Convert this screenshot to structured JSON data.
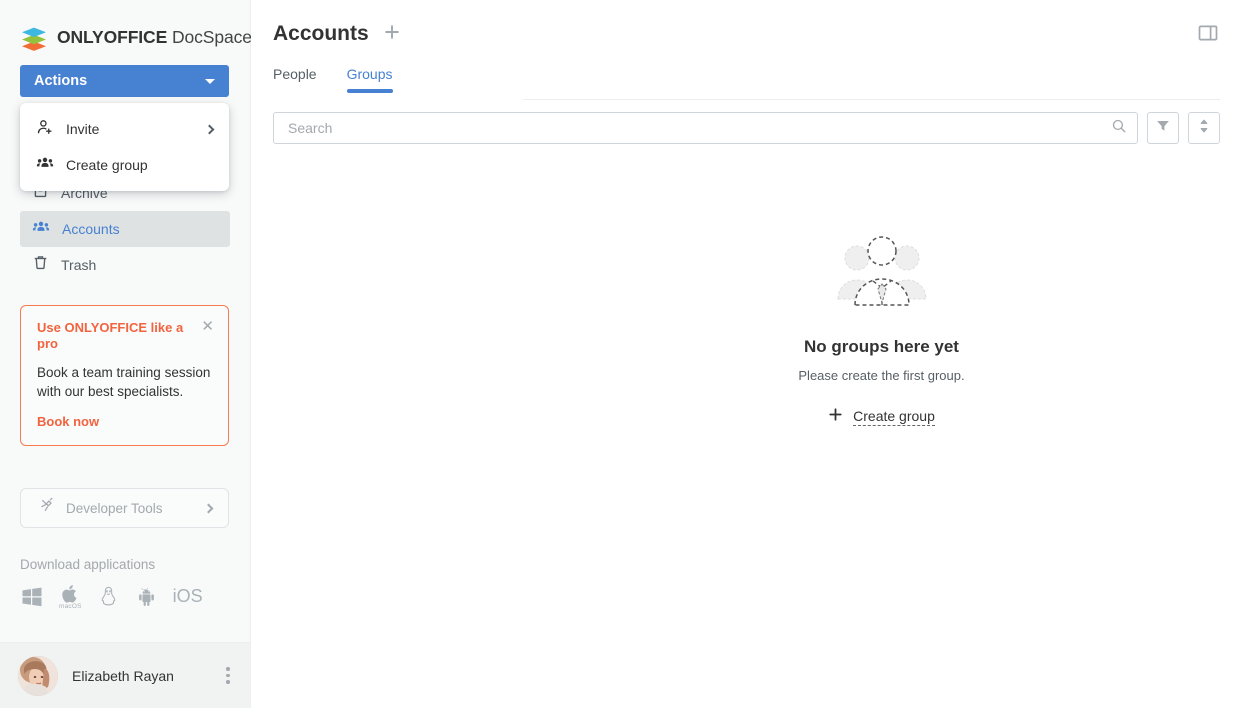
{
  "brand": {
    "bold": "ONLYOFFICE",
    "light": "DocSpace",
    "logo_icon": "onlyoffice-stack-logo"
  },
  "sidebar": {
    "actions_button": {
      "label": "Actions",
      "caret_icon": "chevron-down-icon"
    },
    "dropdown": {
      "items": [
        {
          "label": "Invite",
          "icon": "person-add-icon",
          "submenu_icon": "chevron-right-icon"
        },
        {
          "label": "Create group",
          "icon": "group-icon"
        }
      ]
    },
    "nav": [
      {
        "label": "Archive",
        "icon": "archive-icon",
        "active": false
      },
      {
        "label": "Accounts",
        "icon": "group-icon",
        "active": true
      },
      {
        "label": "Trash",
        "icon": "trash-icon",
        "active": false
      }
    ],
    "promo": {
      "title": "Use ONLYOFFICE like a pro",
      "close_icon": "close-icon",
      "body": "Book a team training session with our best specialists.",
      "link": "Book now",
      "border_color": "#f97a4d",
      "accent_color": "#f2643f"
    },
    "developer_tools": {
      "label": "Developer Tools",
      "icon": "api-plug-icon",
      "chevron_icon": "chevron-right-icon"
    },
    "downloads": {
      "title": "Download applications",
      "items": [
        {
          "name": "windows-icon",
          "label": ""
        },
        {
          "name": "apple-macos-icon",
          "label": "macOS"
        },
        {
          "name": "linux-penguin-icon",
          "label": ""
        },
        {
          "name": "android-icon",
          "label": ""
        },
        {
          "name": "ios-text",
          "label": "iOS"
        }
      ]
    },
    "profile": {
      "name": "Elizabeth Rayan",
      "avatar_icon": "user-avatar",
      "menu_icon": "kebab-menu-icon"
    }
  },
  "main": {
    "title": "Accounts",
    "add_icon": "plus-icon",
    "panel_toggle_icon": "panel-toggle-icon",
    "tabs": [
      {
        "label": "People",
        "active": false
      },
      {
        "label": "Groups",
        "active": true
      }
    ],
    "search": {
      "placeholder": "Search",
      "value": "",
      "search_icon": "search-icon",
      "filter_icon": "filter-icon",
      "sort_icon": "sort-icon"
    },
    "empty_state": {
      "illustration": "group-of-people-illustration",
      "title": "No groups here yet",
      "subtitle": "Please create the first group.",
      "action_label": "Create group",
      "action_icon": "plus-icon"
    }
  },
  "colors": {
    "accent": "#4781d1",
    "promo": "#f2643f",
    "text": "#333333",
    "muted": "#a3a9ae"
  }
}
